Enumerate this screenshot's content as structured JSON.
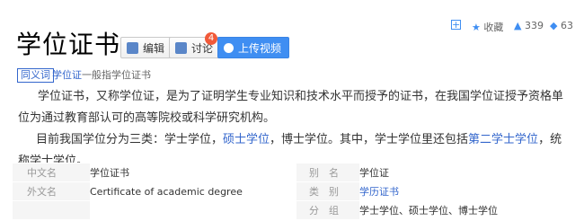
{
  "header": {
    "title": "学位证书",
    "edit_label": "编辑",
    "discuss_label": "讨论",
    "discuss_badge": "4",
    "upload_label": "上传视频"
  },
  "toolbar": {
    "add_icon": "plus-icon",
    "collect_label": "收藏",
    "like_count": "339",
    "share_count": "63"
  },
  "subtitle": {
    "tag": "同义词",
    "term": "学位证",
    "rest": "一般指学位证书"
  },
  "intro": "学位证书，又称学位证，是为了证明学生专业知识和技术水平而授予的证书，在我国学位证授予资格单位为通过教育部认可的高等院校或科学研究机构。",
  "para2": {
    "part1": "目前我国学位分为三类：学士学位，",
    "link1": "硕士学位",
    "part2": "，博士学位。其中，学士学位里还包括",
    "link2": "第二学士学位",
    "part3": "，统称学士学位。"
  },
  "basic_info": {
    "left": [
      {
        "key": "中文名",
        "value": "学位证书"
      },
      {
        "key": "外文名",
        "value": "Certificate of academic degree"
      },
      {
        "key": "",
        "value": ""
      }
    ],
    "right": [
      {
        "key": "别　名",
        "value": "学位证"
      },
      {
        "key": "类　别",
        "value": "学历证书"
      },
      {
        "key": "分　组",
        "value": "学士学位、硕士学位、博士学位"
      }
    ]
  },
  "colors": {
    "link": "#3366cc",
    "upload_button": "#3f8ef2",
    "badge": "#f15a3a"
  }
}
